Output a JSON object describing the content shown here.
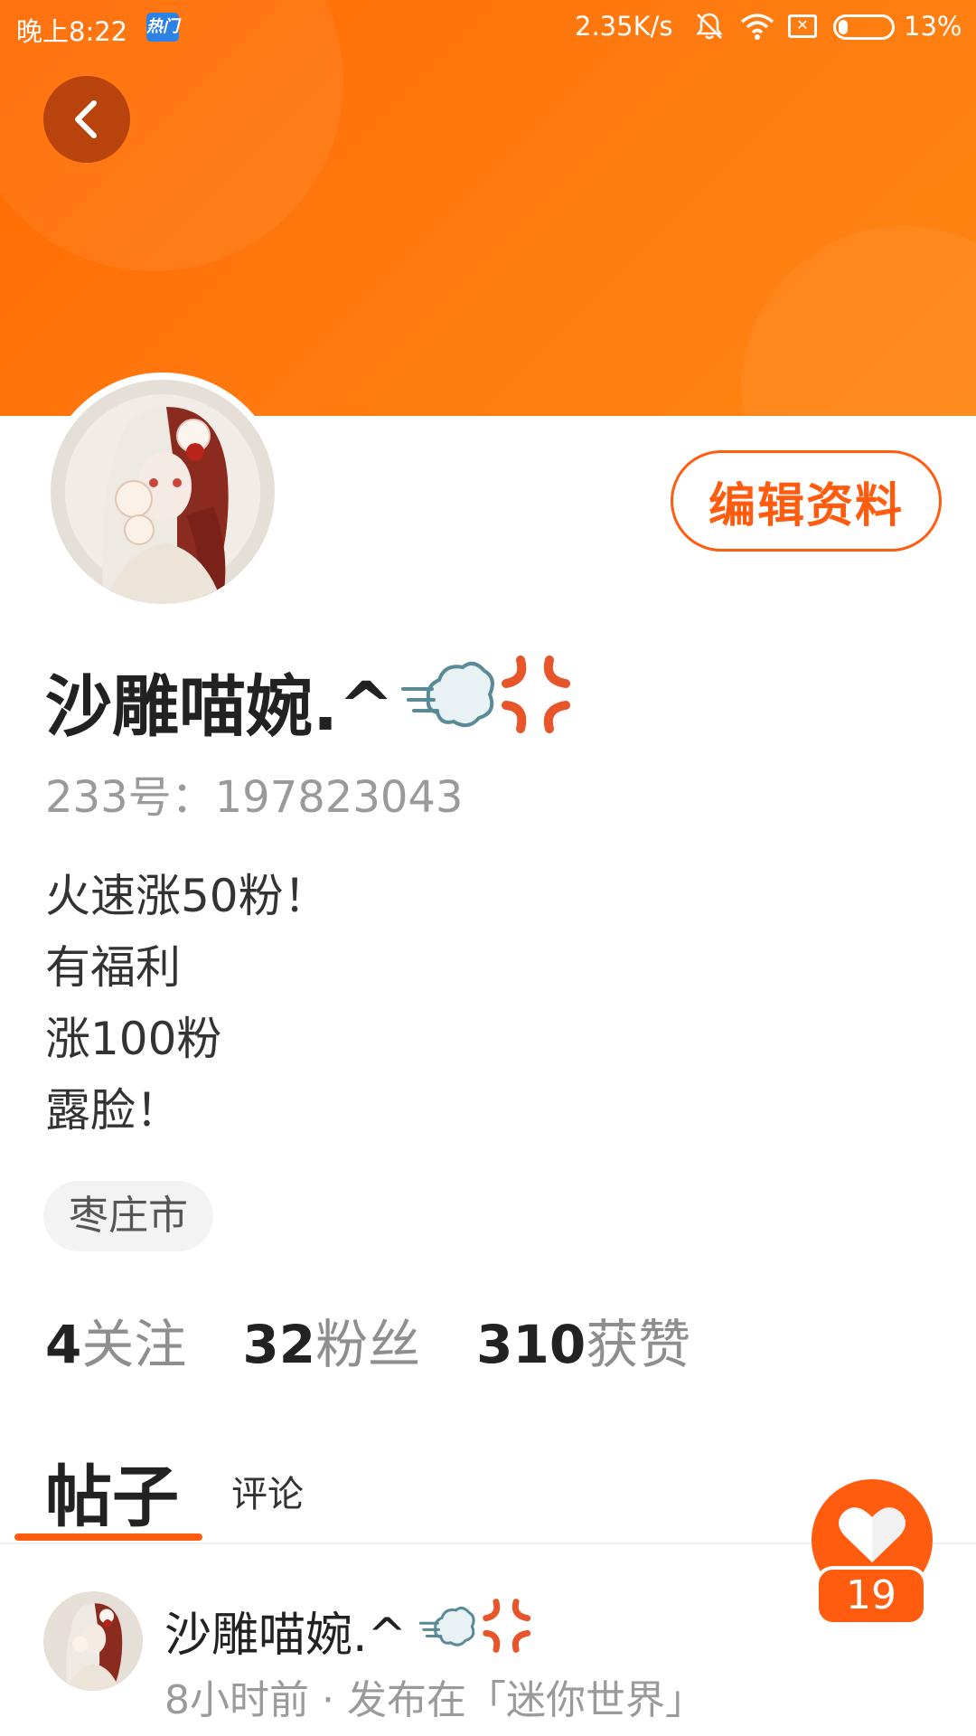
{
  "status_bar": {
    "time": "晚上8:22",
    "hot_badge": "热门",
    "net_speed": "2.35K/s",
    "battery": "13%"
  },
  "profile": {
    "edit_button": "编辑资料",
    "username": "沙雕喵婉.^",
    "user_id": "233号：197823043",
    "bio": [
      "火速涨50粉！",
      "有福利",
      "涨100粉",
      "露脸！"
    ],
    "location": "枣庄市"
  },
  "stats": [
    {
      "value": "4",
      "label": "关注"
    },
    {
      "value": "32",
      "label": "粉丝"
    },
    {
      "value": "310",
      "label": "获赞"
    }
  ],
  "tabs": {
    "posts": "帖子",
    "comments": "评论"
  },
  "like_badge": {
    "count": "19"
  },
  "post": {
    "author": "沙雕喵婉.^",
    "meta": "8小时前 · 发布在「迷你世界」"
  },
  "colors": {
    "accent": "#ff5c10",
    "header": "#ff7410"
  },
  "icons": [
    "back-arrow-icon",
    "bell-off-icon",
    "wifi-icon",
    "no-sim-icon",
    "battery-icon",
    "heart-icon"
  ]
}
